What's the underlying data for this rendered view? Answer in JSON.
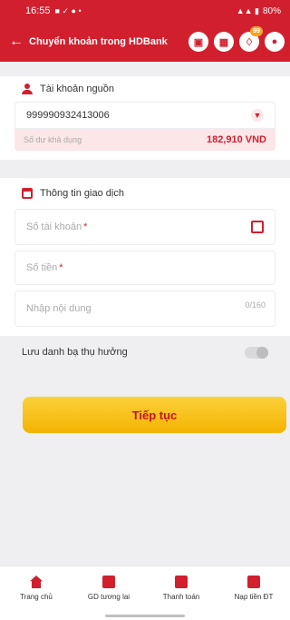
{
  "status_bar": {
    "time": "16:55",
    "battery": "80%"
  },
  "header": {
    "back_icon": "arrow-left-icon",
    "title": "Chuyển khoản trong HDBank",
    "notification_badge": "99"
  },
  "source_account": {
    "title": "Tài khoản nguồn",
    "account_number": "999990932413006",
    "balance_label": "Số dư khả dụng",
    "balance_value": "182,910 VND"
  },
  "transaction": {
    "title": "Thông tin giao dịch",
    "account_field": {
      "placeholder": "Số tài khoản",
      "required_mark": "*"
    },
    "amount_field": {
      "placeholder": "Số tiền",
      "required_mark": "*"
    },
    "content_field": {
      "placeholder": "Nhập nội dung",
      "counter": "0/160"
    }
  },
  "save_contact": {
    "label": "Lưu danh bạ thụ hưởng",
    "enabled": false
  },
  "continue_button": {
    "label": "Tiếp tục"
  },
  "bottom_nav": [
    {
      "label": "Trang chủ",
      "icon": "home-icon"
    },
    {
      "label": "GD tương lai",
      "icon": "future-transaction-icon"
    },
    {
      "label": "Thanh toán",
      "icon": "bill-payment-icon"
    },
    {
      "label": "Nạp tiền ĐT",
      "icon": "phone-topup-icon"
    }
  ],
  "colors": {
    "primary": "#d21f2e",
    "accent": "#f4b300"
  }
}
